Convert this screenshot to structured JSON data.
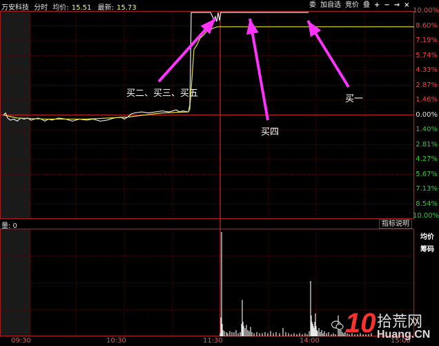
{
  "header": {
    "stock_name": "万安科技",
    "mode": "分时",
    "avg_label": "均价:",
    "avg_value": "15.51",
    "latest_label": "最新:",
    "latest_value": "15.73"
  },
  "toolbar": {
    "wei": "委",
    "add_watchlist": "加自选",
    "bid": "竞价",
    "overlay": "叠",
    "plus": "+",
    "minus": "−",
    "right_arrow": "→",
    "close": "×"
  },
  "price_axis": {
    "labels_up": [
      "10.00%",
      "8.60%",
      "7.19%",
      "5.74%",
      "4.33%",
      "2.87%",
      "1.46%"
    ],
    "label_zero": "0.00%",
    "labels_down": [
      "1.40%",
      "2.81%",
      "4.27%",
      "5.67%",
      "7.13%",
      "8.54%",
      "10.00%"
    ]
  },
  "volume_panel": {
    "label": "量: 0",
    "indicator_button": "指标说明",
    "avg_button": "均价",
    "chip_button": "筹码"
  },
  "time_axis": [
    "09:30",
    "10:30",
    "11:30",
    "14:00",
    "15:00"
  ],
  "annotations": {
    "buy_235": "买二、买三、买五",
    "buy_4": "买四",
    "buy_1": "买一"
  },
  "watermark": {
    "ten": "10",
    "cn": "拾荒网",
    "en": "Huang.CN"
  },
  "colors": {
    "price_line": "#e8e8e8",
    "avg_line": "#e8e040",
    "grid": "#5a0000",
    "arrow": "#ff33ff",
    "up": "#ff4040",
    "down": "#33cc33"
  },
  "chart_data": {
    "type": "line",
    "series": [
      {
        "values_pct": [
          [
            0,
            0.0
          ],
          [
            3,
            0.2
          ],
          [
            6,
            -0.3
          ],
          [
            10,
            -0.5
          ],
          [
            15,
            -0.4
          ],
          [
            20,
            -0.6
          ],
          [
            25,
            -0.3
          ],
          [
            30,
            -0.4
          ],
          [
            35,
            -0.3
          ],
          [
            40,
            -0.5
          ],
          [
            45,
            -0.4
          ],
          [
            50,
            -0.3
          ],
          [
            55,
            -0.4
          ],
          [
            60,
            -0.6
          ],
          [
            65,
            -0.4
          ],
          [
            70,
            -0.5
          ],
          [
            80,
            -0.3
          ],
          [
            90,
            -0.4
          ],
          [
            100,
            -0.6
          ],
          [
            110,
            -0.4
          ],
          [
            120,
            -0.5
          ],
          [
            130,
            -0.4
          ],
          [
            140,
            -0.6
          ],
          [
            150,
            -0.5
          ],
          [
            160,
            -0.3
          ],
          [
            170,
            -0.2
          ],
          [
            175,
            -0.4
          ],
          [
            180,
            -0.2
          ],
          [
            185,
            0.1
          ],
          [
            190,
            0.2
          ],
          [
            200,
            0.3
          ],
          [
            210,
            0.2
          ],
          [
            220,
            0.3
          ],
          [
            230,
            0.4
          ],
          [
            240,
            0.3
          ],
          [
            250,
            0.5
          ],
          [
            255,
            0.3
          ],
          [
            260,
            0.4
          ],
          [
            268,
            0.3
          ],
          [
            270,
            1.0
          ],
          [
            271,
            5.0
          ],
          [
            272,
            10.0
          ],
          [
            300,
            10.0
          ],
          [
            305,
            9.3
          ],
          [
            307,
            9.6
          ],
          [
            309,
            9.1
          ],
          [
            311,
            10.0
          ],
          [
            313,
            9.2
          ],
          [
            315,
            10.0
          ],
          [
            330,
            10.0
          ]
        ]
      },
      {
        "values_pct": [
          [
            0,
            0.0
          ],
          [
            20,
            -0.3
          ],
          [
            60,
            -0.4
          ],
          [
            120,
            -0.4
          ],
          [
            180,
            -0.2
          ],
          [
            230,
            0.2
          ],
          [
            268,
            0.3
          ],
          [
            270,
            0.6
          ],
          [
            273,
            3.5
          ],
          [
            276,
            6.4
          ],
          [
            280,
            6.8
          ],
          [
            285,
            7.5
          ],
          [
            290,
            7.8
          ],
          [
            295,
            8.2
          ],
          [
            300,
            8.3
          ],
          [
            305,
            8.5
          ],
          [
            310,
            8.6
          ],
          [
            330,
            8.6
          ]
        ]
      }
    ],
    "x_range_minutes": [
      0,
      240
    ],
    "ylim_pct": [
      -10,
      10
    ],
    "volume": [
      [
        269,
        3
      ],
      [
        270,
        18
      ],
      [
        271,
        100
      ],
      [
        272,
        12
      ],
      [
        273,
        6
      ],
      [
        275,
        5
      ],
      [
        278,
        4
      ],
      [
        280,
        3
      ],
      [
        283,
        5
      ],
      [
        286,
        4
      ],
      [
        289,
        4
      ],
      [
        292,
        6
      ],
      [
        295,
        3
      ],
      [
        298,
        4
      ],
      [
        300,
        12
      ],
      [
        301,
        35
      ],
      [
        302,
        14
      ],
      [
        303,
        10
      ],
      [
        305,
        8
      ],
      [
        307,
        11
      ],
      [
        309,
        6
      ],
      [
        311,
        5
      ],
      [
        313,
        9
      ],
      [
        315,
        4
      ],
      [
        318,
        3
      ],
      [
        322,
        4
      ],
      [
        326,
        3
      ],
      [
        330,
        3
      ],
      [
        334,
        4
      ],
      [
        338,
        3
      ],
      [
        342,
        5
      ],
      [
        346,
        3
      ],
      [
        350,
        4
      ],
      [
        355,
        3
      ],
      [
        360,
        8
      ],
      [
        364,
        4
      ],
      [
        368,
        3
      ],
      [
        372,
        2
      ],
      [
        376,
        3
      ],
      [
        380,
        2
      ],
      [
        384,
        3
      ],
      [
        388,
        2
      ],
      [
        392,
        3
      ],
      [
        395,
        2
      ],
      [
        398,
        5
      ],
      [
        400,
        53
      ],
      [
        401,
        20
      ],
      [
        402,
        14
      ],
      [
        403,
        12
      ],
      [
        404,
        10
      ],
      [
        405,
        8
      ],
      [
        406,
        14
      ],
      [
        407,
        22
      ],
      [
        408,
        10
      ],
      [
        409,
        6
      ],
      [
        410,
        5
      ],
      [
        412,
        8
      ],
      [
        414,
        4
      ],
      [
        416,
        6
      ],
      [
        418,
        3
      ],
      [
        420,
        5
      ],
      [
        423,
        3
      ],
      [
        426,
        4
      ],
      [
        430,
        2
      ],
      [
        433,
        3
      ],
      [
        436,
        2
      ],
      [
        440,
        20
      ],
      [
        442,
        8
      ],
      [
        444,
        6
      ],
      [
        446,
        4
      ],
      [
        448,
        3
      ],
      [
        450,
        4
      ],
      [
        453,
        3
      ],
      [
        456,
        2
      ],
      [
        460,
        3
      ],
      [
        464,
        2
      ],
      [
        468,
        2
      ],
      [
        472,
        3
      ],
      [
        476,
        2
      ],
      [
        480,
        2
      ],
      [
        484,
        2
      ],
      [
        488,
        3
      ]
    ]
  }
}
